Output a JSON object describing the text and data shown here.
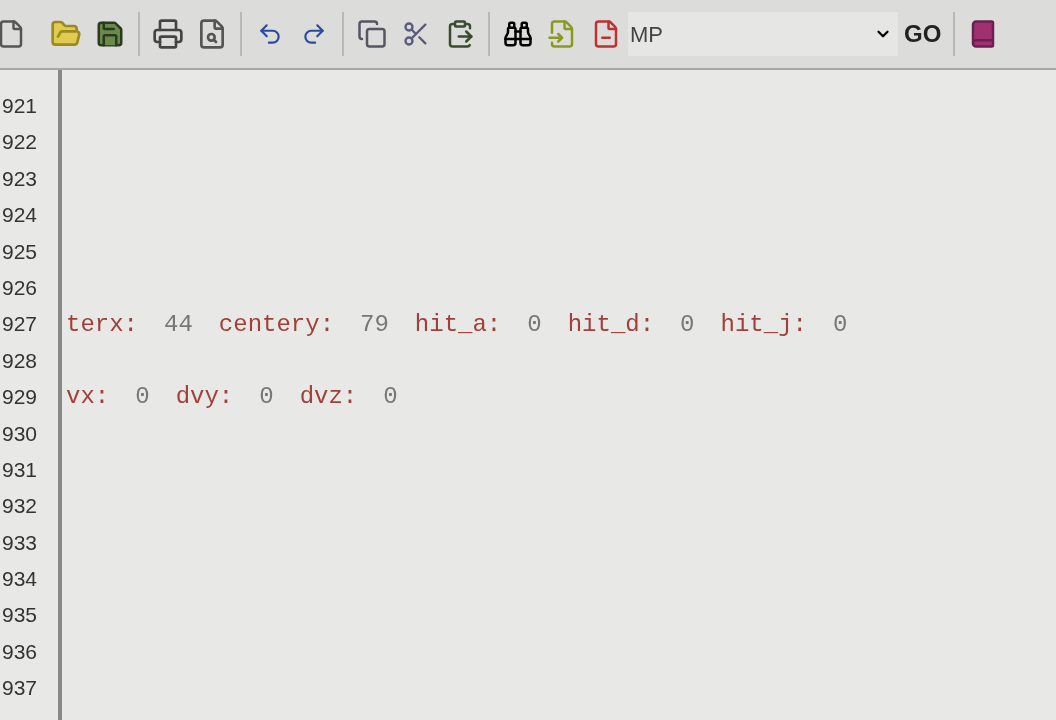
{
  "toolbar": {
    "combo_value": "MP",
    "go_label": "GO"
  },
  "editor": {
    "lines": [
      {
        "number": "921"
      },
      {
        "number": "922"
      },
      {
        "number": "923"
      },
      {
        "number": "924"
      },
      {
        "number": "925"
      },
      {
        "number": "926"
      },
      {
        "number": "927",
        "tokens": [
          {
            "text": "terx:",
            "kind": "key"
          },
          {
            "text": "44",
            "kind": "value"
          },
          {
            "text": "centery:",
            "kind": "key"
          },
          {
            "text": "79",
            "kind": "value"
          },
          {
            "text": "hit_a:",
            "kind": "key"
          },
          {
            "text": "0",
            "kind": "value"
          },
          {
            "text": "hit_d:",
            "kind": "key"
          },
          {
            "text": "0",
            "kind": "value"
          },
          {
            "text": "hit_j:",
            "kind": "key"
          },
          {
            "text": "0",
            "kind": "value"
          }
        ]
      },
      {
        "number": "928"
      },
      {
        "number": "929",
        "tokens": [
          {
            "text": "vx:",
            "kind": "key"
          },
          {
            "text": "0",
            "kind": "value"
          },
          {
            "text": "dvy:",
            "kind": "key"
          },
          {
            "text": "0",
            "kind": "value"
          },
          {
            "text": "dvz:",
            "kind": "key"
          },
          {
            "text": "0",
            "kind": "value"
          }
        ]
      },
      {
        "number": "930"
      },
      {
        "number": "931"
      },
      {
        "number": "932"
      },
      {
        "number": "933"
      },
      {
        "number": "934"
      },
      {
        "number": "935"
      },
      {
        "number": "936"
      },
      {
        "number": "937"
      }
    ]
  }
}
